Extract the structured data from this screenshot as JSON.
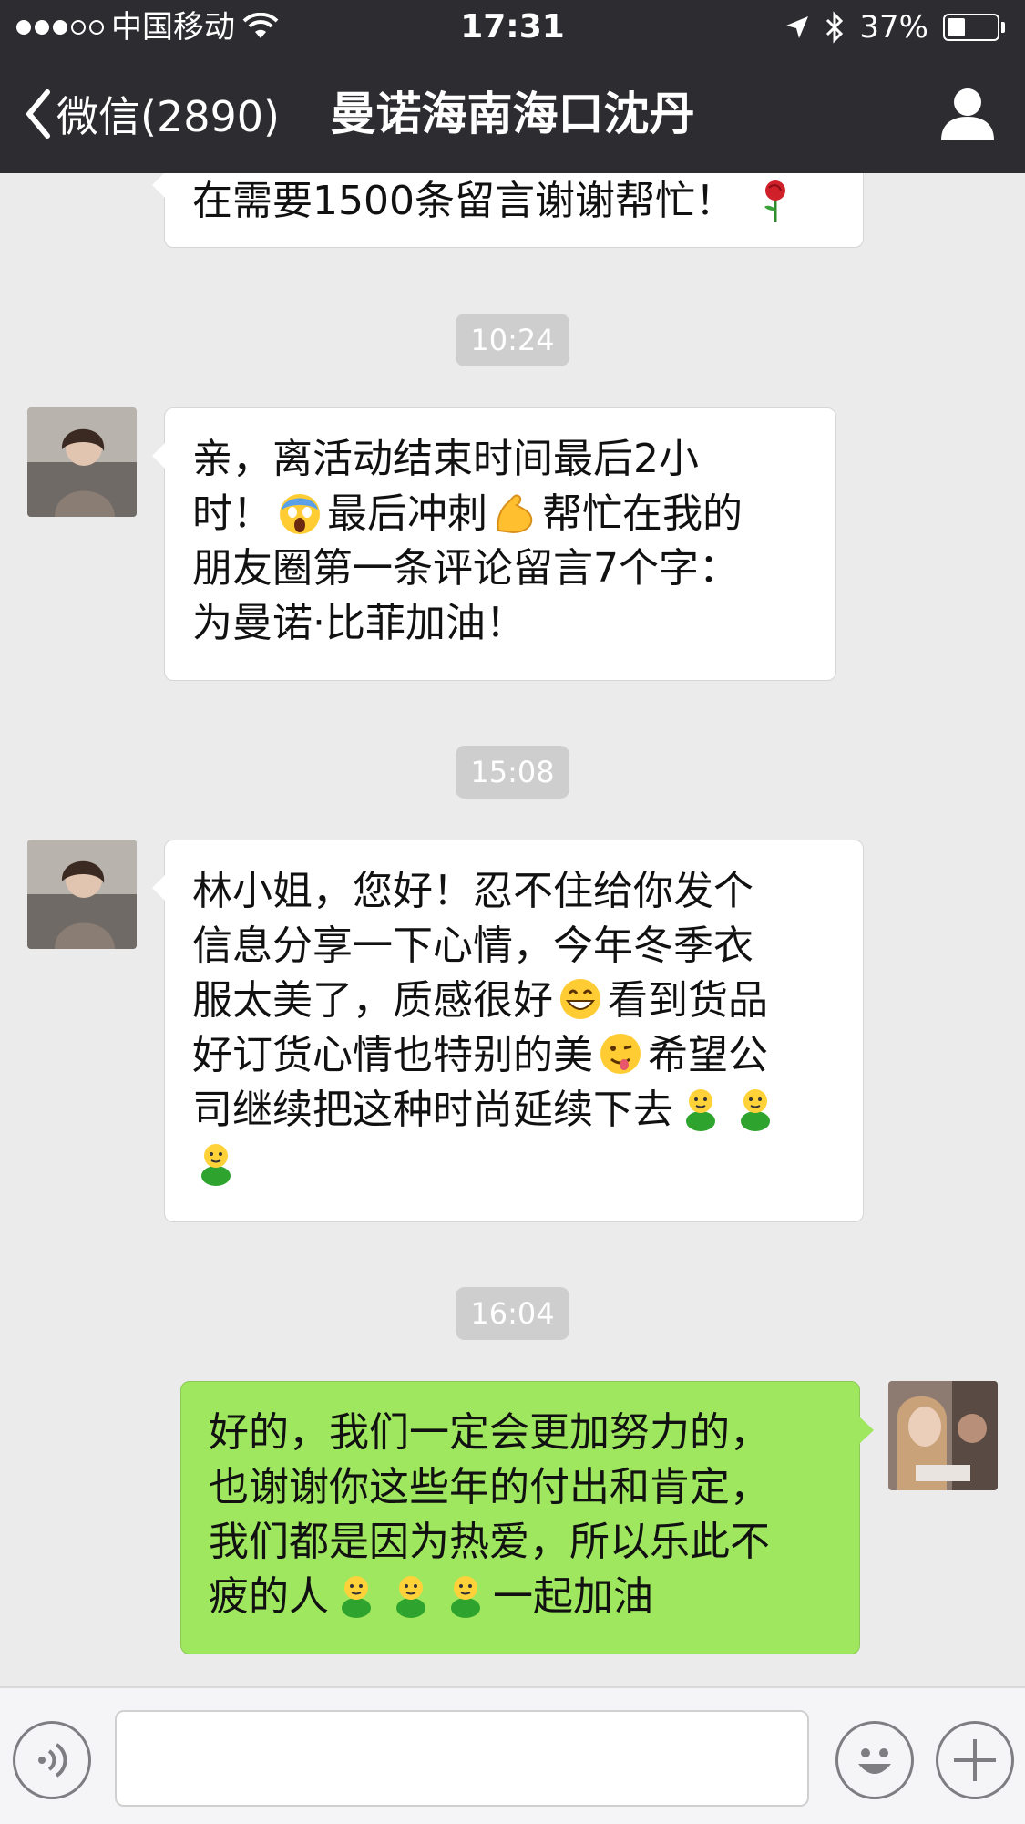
{
  "status_bar": {
    "carrier": "中国移动",
    "time": "17:31",
    "battery": "37%",
    "battery_level": 0.37
  },
  "nav": {
    "back_label": "微信(2890)",
    "title": "曼诺海南海口沈丹"
  },
  "messages": {
    "m0": {
      "text": "在需要1500条留言谢谢帮忙！"
    },
    "ts1": "10:24",
    "m1": {
      "line1": "亲，离活动结束时间最后2小",
      "line2a": "时！",
      "line2b": "最后冲刺",
      "line2c": "帮忙在我的",
      "line3": "朋友圈第一条评论留言7个字：",
      "line4": "为曼诺·比菲加油！"
    },
    "ts2": "15:08",
    "m2": {
      "line1": "林小姐，您好！忍不住给你发个",
      "line2": "信息分享一下心情，今年冬季衣",
      "line3a": "服太美了，质感很好",
      "line3b": "看到货品",
      "line4a": "好订货心情也特别的美",
      "line4b": "希望公",
      "line5": "司继续把这种时尚延续下去"
    },
    "ts3": "16:04",
    "m3": {
      "line1": "好的，我们一定会更加努力的，",
      "line2": "也谢谢你这些年的付出和肯定，",
      "line3": "我们都是因为热爱，所以乐此不",
      "line4a": "疲的人",
      "line4b": "一起加油"
    }
  },
  "colors": {
    "nav_bg": "#2d2d31",
    "chat_bg": "#ebebeb",
    "incoming_bubble": "#ffffff",
    "outgoing_bubble": "#9fe75f"
  }
}
